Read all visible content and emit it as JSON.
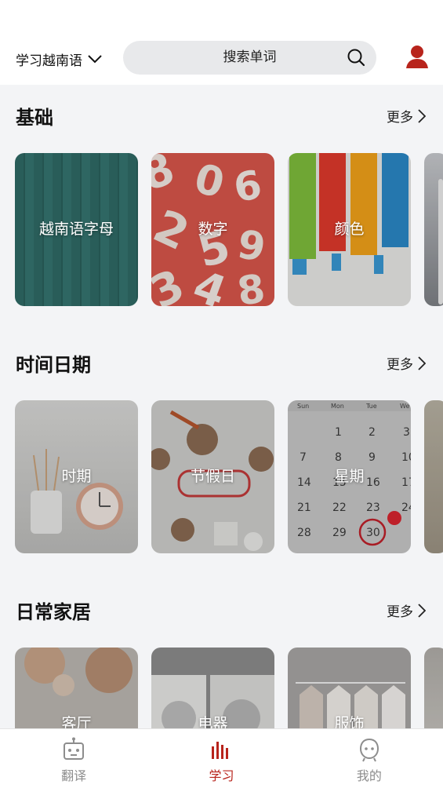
{
  "header": {
    "language_label": "学习越南语",
    "search_placeholder": "搜索单词"
  },
  "sections": [
    {
      "title": "基础",
      "more_label": "更多",
      "cards": [
        {
          "label": "越南语字母"
        },
        {
          "label": "数字"
        },
        {
          "label": "颜色"
        },
        {
          "label": ""
        }
      ]
    },
    {
      "title": "时间日期",
      "more_label": "更多",
      "cards": [
        {
          "label": "时期"
        },
        {
          "label": "节假日"
        },
        {
          "label": "星期"
        },
        {
          "label": ""
        }
      ]
    },
    {
      "title": "日常家居",
      "more_label": "更多",
      "cards": [
        {
          "label": "客厅"
        },
        {
          "label": "电器"
        },
        {
          "label": "服饰"
        },
        {
          "label": ""
        }
      ]
    }
  ],
  "bottom_nav": [
    {
      "label": "翻译",
      "icon": "robot-icon",
      "active": false
    },
    {
      "label": "学习",
      "icon": "bars-icon",
      "active": true
    },
    {
      "label": "我的",
      "icon": "face-icon",
      "active": false
    }
  ],
  "colors": {
    "accent": "#b8241c",
    "nav_inactive": "#8d8d8d",
    "background": "#f3f4f6"
  }
}
